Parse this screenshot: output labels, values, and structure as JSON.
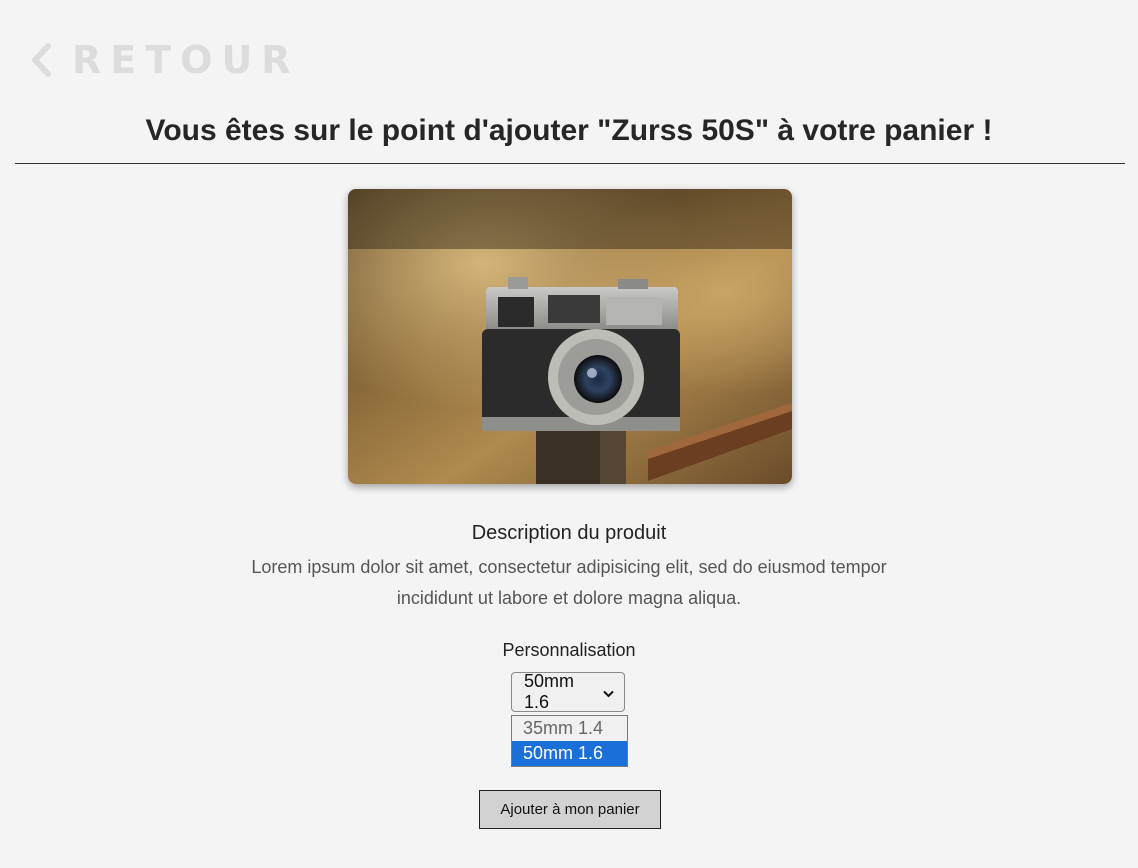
{
  "nav": {
    "back_label": "RETOUR",
    "back_icon": "chevron-left-icon"
  },
  "header": {
    "title": "Vous êtes sur le point d'ajouter \"Zurss 50S\" à votre panier !"
  },
  "product": {
    "image_subject": "vintage rangefinder camera",
    "description_title": "Description du produit",
    "description_text": "Lorem ipsum dolor sit amet, consectetur adipisicing elit, sed do eiusmod tempor incididunt ut labore et dolore magna aliqua."
  },
  "customization": {
    "label": "Personnalisation",
    "selected_value": "50mm 1.6",
    "options": [
      "35mm 1.4",
      "50mm 1.6"
    ]
  },
  "actions": {
    "add_to_cart_label": "Ajouter à mon panier"
  },
  "colors": {
    "background": "#f4f4f4",
    "back_link": "#dcdcdc",
    "selected_option": "#1a6fd8",
    "button_bg": "#d2d2d2"
  }
}
